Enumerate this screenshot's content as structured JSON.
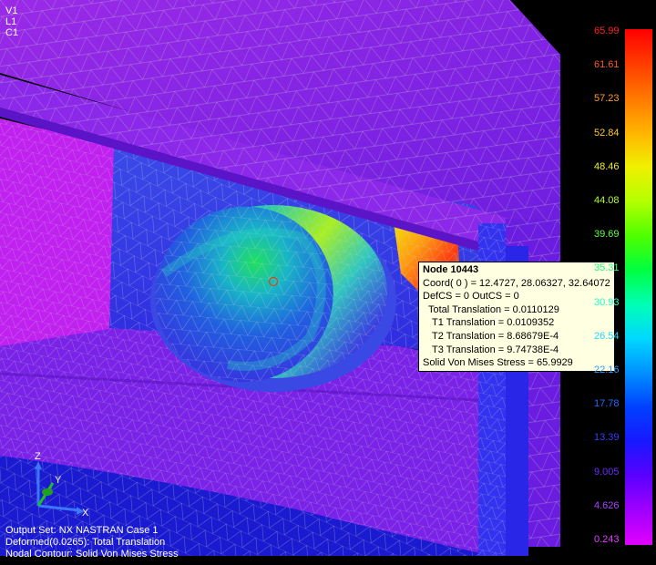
{
  "view_tags": {
    "view": "V1",
    "layer": "L1",
    "csys": "C1"
  },
  "legend": {
    "values": [
      "65.99",
      "61.61",
      "57.23",
      "52.84",
      "48.46",
      "44.08",
      "39.69",
      "35.31",
      "30.93",
      "26.54",
      "22.16",
      "17.78",
      "13.39",
      "9.005",
      "4.626",
      "0.243"
    ],
    "colors": [
      "#ff0000",
      "#ff3c00",
      "#ff7800",
      "#ffb400",
      "#f0f000",
      "#b4ff00",
      "#50ff00",
      "#00ff40",
      "#00ffb4",
      "#00d8ff",
      "#0090ff",
      "#0040ff",
      "#1818ff",
      "#5a00ff",
      "#a000ff",
      "#e000ff"
    ],
    "label_colors": [
      "#ff2020",
      "#ff5a1e",
      "#ff9a28",
      "#ffc830",
      "#f0f020",
      "#b4ff30",
      "#60ff40",
      "#20ff80",
      "#20ffc8",
      "#20d8ff",
      "#2a9cff",
      "#2a6aff",
      "#3a3aff",
      "#6a2cff",
      "#b040ff",
      "#e040ff"
    ]
  },
  "tooltip": {
    "node": "Node 10443",
    "coord": "Coord( 0 ) = 12.4727, 28.06327, 32.64072",
    "cs": "DefCS = 0  OutCS = 0",
    "total": "Total Translation = 0.0110129",
    "t1": "T1 Translation = 0.0109352",
    "t2": "T2 Translation = 8.68679E-4",
    "t3": "T3 Translation = 9.74738E-4",
    "stress": "Solid Von Mises Stress = 65.9929"
  },
  "output": {
    "set": "Output Set: NX NASTRAN Case 1",
    "deformed": "Deformed(0.0265): Total Translation",
    "contour": "Nodal Contour: Solid Von Mises Stress"
  },
  "triad": {
    "x": "X",
    "y": "Y",
    "z": "Z",
    "x_color": "#3a78ff",
    "y_color": "#21c021",
    "z_color": "#3a78ff"
  }
}
